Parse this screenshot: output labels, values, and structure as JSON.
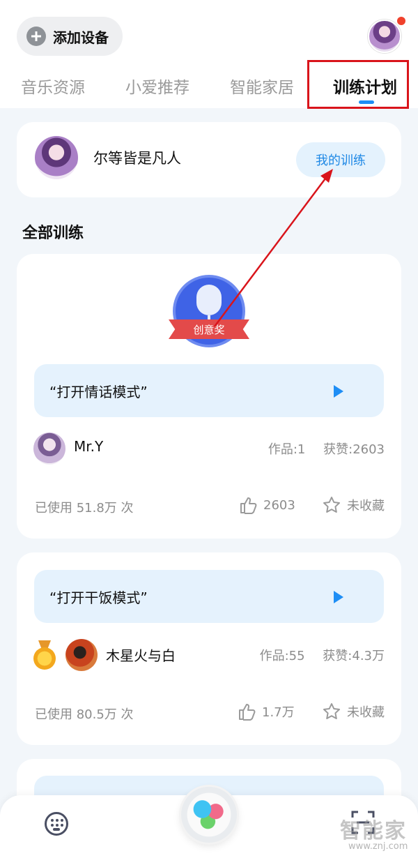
{
  "header": {
    "add_device_label": "添加设备",
    "tabs": [
      {
        "label": "音乐资源"
      },
      {
        "label": "小爱推荐"
      },
      {
        "label": "智能家居"
      },
      {
        "label": "训练计划"
      }
    ],
    "active_tab": "训练计划"
  },
  "user_card": {
    "name": "尔等皆是凡人",
    "my_training_label": "我的训练"
  },
  "section_title": "全部训练",
  "trainings": [
    {
      "award_label": "创意奖",
      "phrase": "“打开情话模式”",
      "author": "Mr.Y",
      "works": "作品:1",
      "likes_received": "获赞:2603",
      "usage": "已使用 51.8万 次",
      "like_count": "2603",
      "favorite_label": "未收藏"
    },
    {
      "phrase": "“打开干饭模式”",
      "author": "木星火与白",
      "works": "作品:55",
      "likes_received": "获赞:4.3万",
      "usage": "已使用 80.5万 次",
      "like_count": "1.7万",
      "favorite_label": "未收藏"
    },
    {
      "phrase": "“..."
    }
  ],
  "watermark": {
    "brand": "智能家",
    "url": "www.znj.com"
  },
  "colors": {
    "accent_blue": "#1e8ef5",
    "highlight_red": "#d9141b",
    "phrase_bg": "#e5f2fd"
  }
}
